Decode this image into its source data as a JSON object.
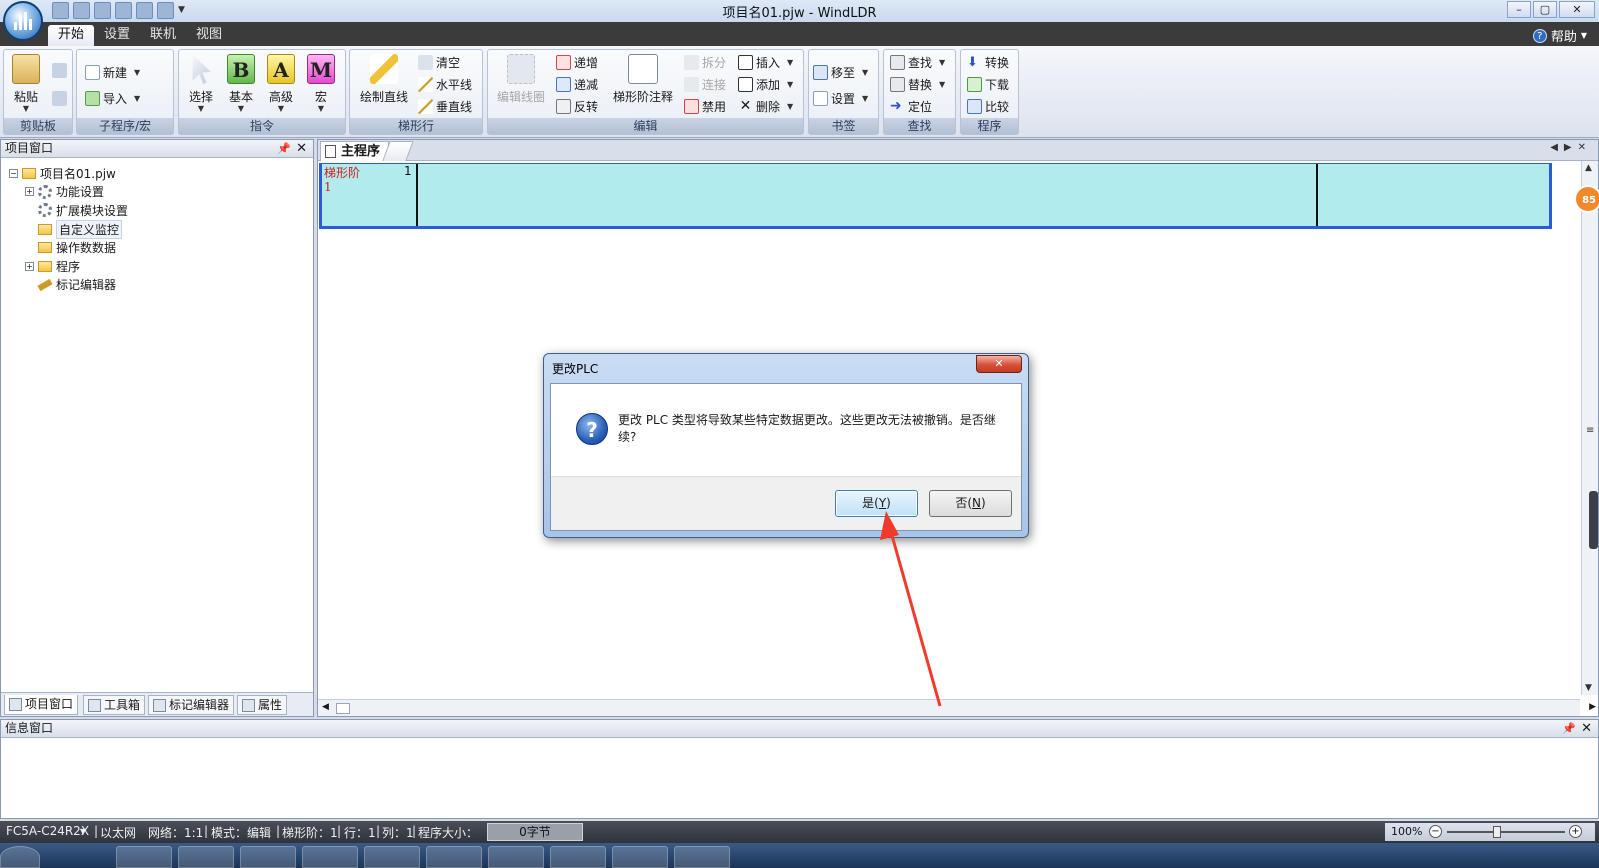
{
  "window": {
    "title": "项目名01.pjw - WindLDR",
    "minimize": "–",
    "maximize": "▢",
    "close": "✕"
  },
  "ribbon_tabs": [
    "开始",
    "设置",
    "联机",
    "视图"
  ],
  "help_label": "帮助",
  "ribbon": {
    "clipboard": {
      "label": "剪贴板",
      "paste": "粘贴"
    },
    "subroutine": {
      "label": "子程序/宏",
      "new": "新建",
      "import": "导入"
    },
    "instructions": {
      "label": "指令",
      "select": "选择",
      "basic": "基本",
      "advanced": "高级",
      "macro": "宏",
      "b": "B",
      "a": "A",
      "m": "M"
    },
    "rung_line": {
      "label": "梯形行",
      "draw_line": "绘制直线",
      "clear": "清空",
      "hline": "水平线",
      "vline": "垂直线"
    },
    "edit": {
      "label": "编辑",
      "edit_coil": "编辑线圈",
      "increment": "递增",
      "decrement": "递减",
      "invert": "反转",
      "rung_comment": "梯形阶注释",
      "split": "拆分",
      "join": "连接",
      "disable": "禁用",
      "insert": "插入",
      "add": "添加",
      "delete": "删除"
    },
    "bookmark": {
      "label": "书签",
      "move": "移至",
      "set": "设置"
    },
    "find": {
      "label": "查找",
      "find": "查找",
      "replace": "替换",
      "goto": "定位"
    },
    "program": {
      "label": "程序",
      "convert": "转换",
      "download": "下载",
      "compare": "比较"
    }
  },
  "project_pane": {
    "title": "项目窗口",
    "tree": [
      {
        "label": "项目名01.pjw",
        "expand": "−"
      },
      {
        "label": "功能设置",
        "expand": "+"
      },
      {
        "label": "扩展模块设置"
      },
      {
        "label": "自定义监控"
      },
      {
        "label": "操作数数据"
      },
      {
        "label": "程序",
        "expand": "+"
      },
      {
        "label": "标记编辑器"
      }
    ],
    "tabs": [
      "项目窗口",
      "工具箱",
      "标记编辑器",
      "属性"
    ]
  },
  "editor": {
    "tab": "主程序",
    "rung_label": "梯形阶",
    "rung_number": "1",
    "rung_index": "1",
    "badge": "85"
  },
  "dialog": {
    "title": "更改PLC",
    "message": "更改 PLC 类型将导致某些特定数据更改。这些更改无法被撤销。是否继续?",
    "yes": {
      "label": "是(",
      "key": "Y",
      "end": ")"
    },
    "no": {
      "label": "否(",
      "key": "N",
      "end": ")"
    }
  },
  "info_pane": {
    "title": "信息窗口"
  },
  "statusbar": {
    "plc": "FC5A-C24R2X",
    "network_type": "以太网",
    "network": "网络：1:1",
    "mode": "模式：编辑",
    "rung": "梯形阶：1",
    "row": "行：1",
    "col": "列：1",
    "prog_size_label": "程序大小：",
    "prog_size": "0字节",
    "zoom": "100%"
  }
}
